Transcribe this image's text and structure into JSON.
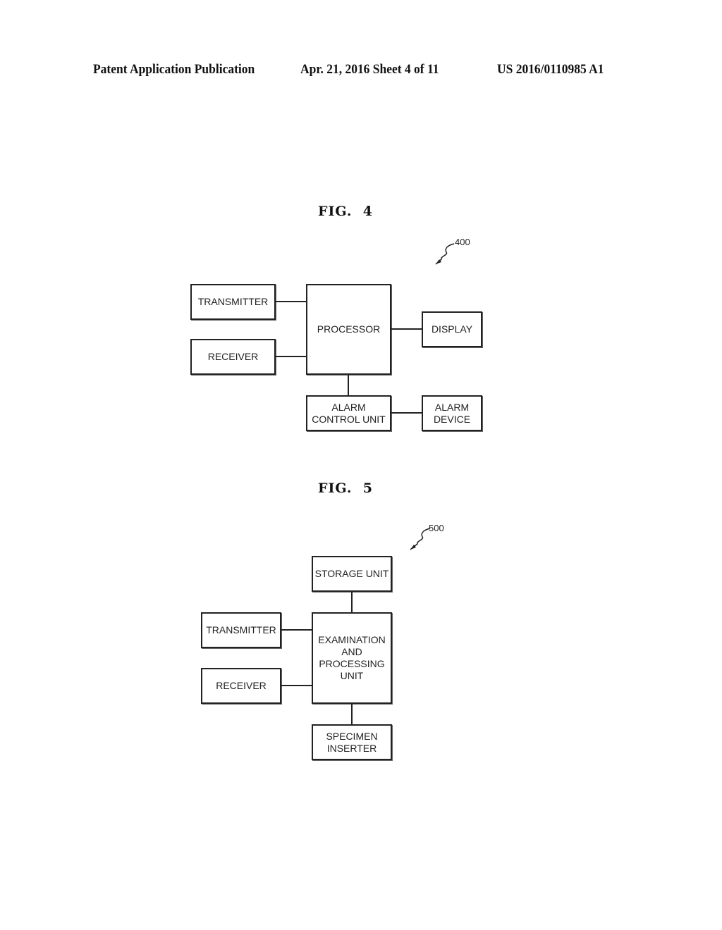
{
  "header": {
    "left": "Patent Application Publication",
    "center": "Apr. 21, 2016  Sheet 4 of 11",
    "right": "US 2016/0110985 A1"
  },
  "fig4": {
    "title": "FIG.  4",
    "ref": "400",
    "boxes": {
      "transmitter": "TRANSMITTER",
      "receiver": "RECEIVER",
      "processor": "PROCESSOR",
      "display": "DISPLAY",
      "alarm_control_unit": "ALARM\nCONTROL UNIT",
      "alarm_device": "ALARM\nDEVICE"
    }
  },
  "fig5": {
    "title": "FIG.  5",
    "ref": "500",
    "boxes": {
      "storage_unit": "STORAGE UNIT",
      "transmitter": "TRANSMITTER",
      "receiver": "RECEIVER",
      "examination_unit": "EXAMINATION\nAND\nPROCESSING\nUNIT",
      "specimen_inserter": "SPECIMEN\nINSERTER"
    }
  }
}
